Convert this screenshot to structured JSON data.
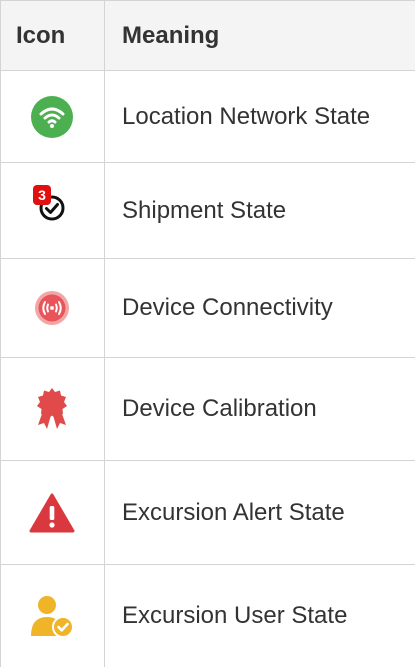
{
  "table": {
    "headers": {
      "icon": "Icon",
      "meaning": "Meaning"
    },
    "rows": [
      {
        "icon": "wifi-circle-icon",
        "meaning": "Location Network State",
        "color": "#4caf50"
      },
      {
        "icon": "check-circle-badge-icon",
        "meaning": "Shipment State",
        "badge": "3",
        "color": "#111111",
        "badge_color": "#e01010"
      },
      {
        "icon": "broadcast-device-icon",
        "meaning": "Device Connectivity",
        "color": "#e8545a"
      },
      {
        "icon": "award-ribbon-icon",
        "meaning": "Device Calibration",
        "color": "#e04a4a"
      },
      {
        "icon": "warning-triangle-icon",
        "meaning": "Excursion Alert State",
        "color": "#d9393e"
      },
      {
        "icon": "user-check-icon",
        "meaning": "Excursion User State",
        "color": "#f0b429"
      }
    ]
  }
}
